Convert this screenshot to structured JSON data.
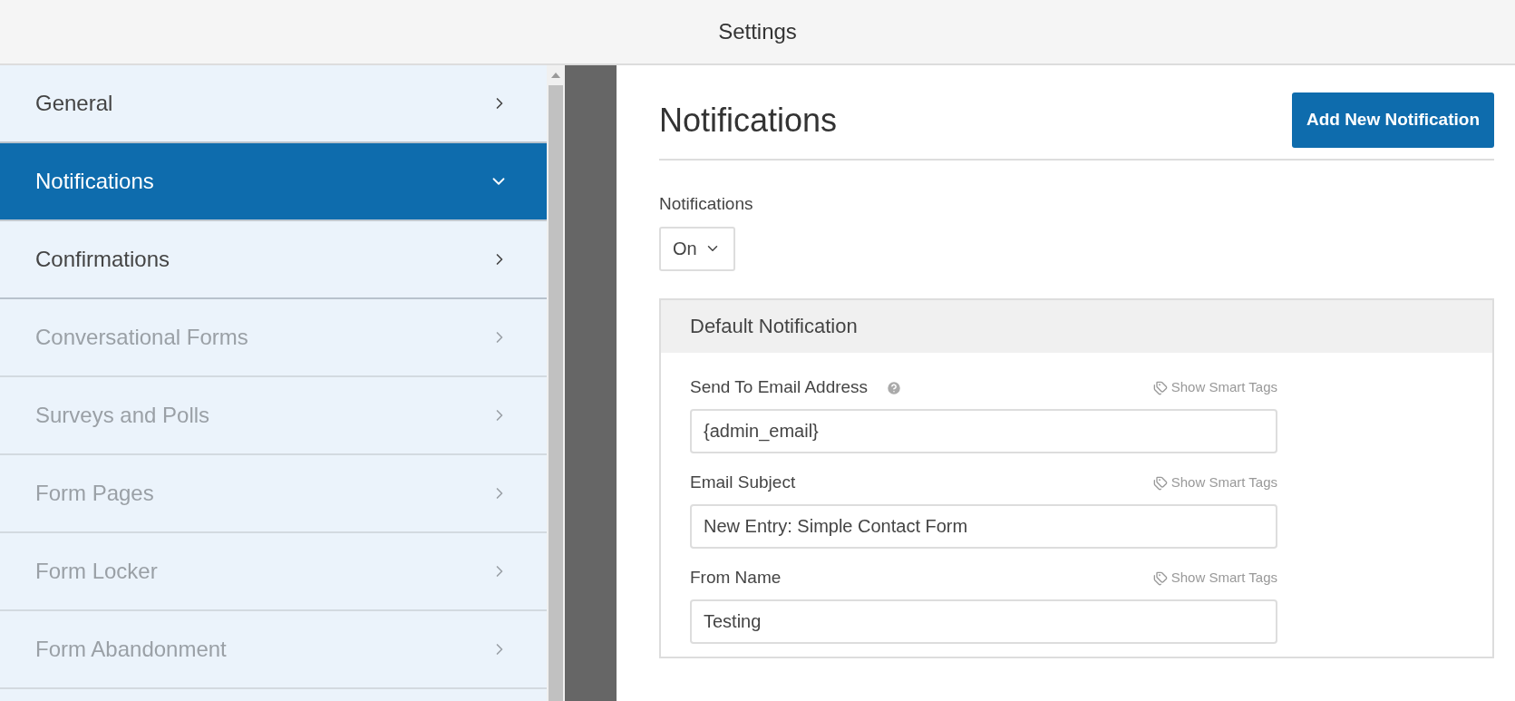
{
  "window": {
    "title": "Settings"
  },
  "sidebar": {
    "items": [
      {
        "label": "General",
        "selected": false,
        "disabled": false
      },
      {
        "label": "Notifications",
        "selected": true,
        "disabled": false
      },
      {
        "label": "Confirmations",
        "selected": false,
        "disabled": false
      },
      {
        "label": "Conversational Forms",
        "selected": false,
        "disabled": true
      },
      {
        "label": "Surveys and Polls",
        "selected": false,
        "disabled": true
      },
      {
        "label": "Form Pages",
        "selected": false,
        "disabled": true
      },
      {
        "label": "Form Locker",
        "selected": false,
        "disabled": true
      },
      {
        "label": "Form Abandonment",
        "selected": false,
        "disabled": true
      }
    ]
  },
  "content": {
    "title": "Notifications",
    "add_button": "Add New Notification",
    "toggle": {
      "label": "Notifications",
      "value": "On"
    },
    "panel": {
      "title": "Default Notification",
      "fields": [
        {
          "label": "Send To Email Address",
          "help": true,
          "smart_tags": "Show Smart Tags",
          "value": "{admin_email}"
        },
        {
          "label": "Email Subject",
          "help": false,
          "smart_tags": "Show Smart Tags",
          "value": "New Entry: Simple Contact Form"
        },
        {
          "label": "From Name",
          "help": false,
          "smart_tags": "Show Smart Tags",
          "value": "Testing"
        }
      ]
    }
  }
}
